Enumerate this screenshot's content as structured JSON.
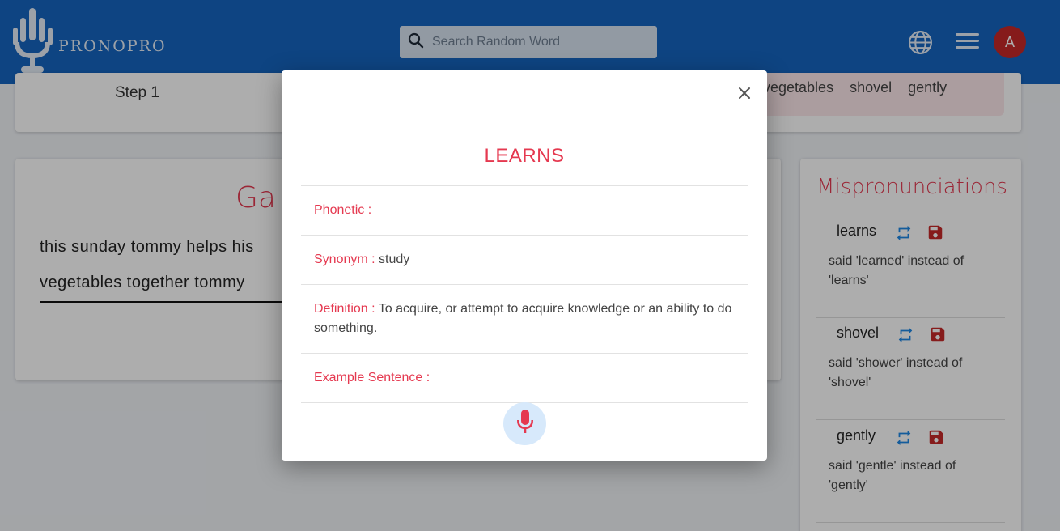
{
  "header": {
    "logo_text": "PRONOPRO",
    "search_placeholder": "Search Random Word",
    "avatar_initial": "A",
    "icons": [
      "mic-logo-icon",
      "search-icon",
      "globe-icon",
      "menu-icon"
    ]
  },
  "background": {
    "step_label": "Step 1",
    "chips": [
      "vegetables",
      "shovel",
      "gently"
    ],
    "game_title": "Ga",
    "sentence_line1": "this sunday tommy helps his",
    "sentence_line2": "vegetables together tommy"
  },
  "mispronunciations": {
    "title": "Mispronunciations",
    "items": [
      {
        "word": "learns",
        "description": "said 'learned' instead of 'learns'"
      },
      {
        "word": "shovel",
        "description": "said 'shower' instead of 'shovel'"
      },
      {
        "word": "gently",
        "description": "said 'gentle' instead of 'gently'"
      }
    ]
  },
  "modal": {
    "word": "LEARNS",
    "phonetic_label": "Phonetic :",
    "phonetic_value": "",
    "synonym_label": "Synonym :",
    "synonym_value": "study",
    "definition_label": "Definition :",
    "definition_value": "To acquire, or attempt to acquire knowledge or an ability to do something.",
    "example_label": "Example Sentence :",
    "example_value": ""
  },
  "colors": {
    "header_bg": "#1565c0",
    "accent_red": "#e53950",
    "icon_blue": "#1e88e5",
    "save_red": "#c62828",
    "mic_bg": "#d7e9fb"
  }
}
